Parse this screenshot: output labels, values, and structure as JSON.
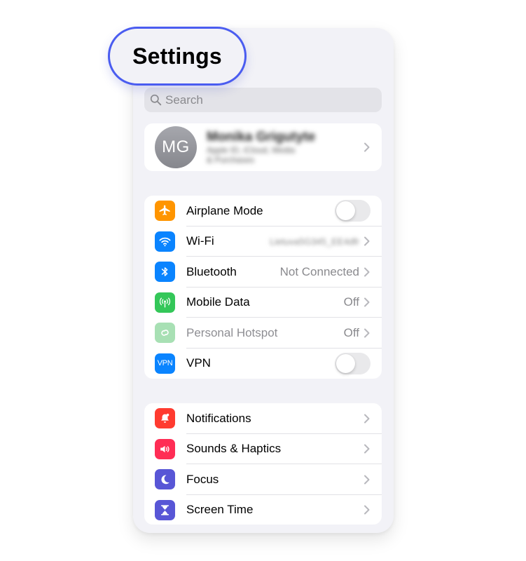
{
  "header": {
    "title": "Settings"
  },
  "search": {
    "placeholder": "Search"
  },
  "profile": {
    "initials": "MG",
    "name": "Monika Grigutyte",
    "subtitle_line1": "Apple ID, iCloud, Media",
    "subtitle_line2": "& Purchases"
  },
  "connectivity": [
    {
      "label": "Airplane Mode",
      "control": "toggle",
      "on": false,
      "color": "#ff9500",
      "icon": "airplane-icon"
    },
    {
      "label": "Wi-Fi",
      "value": "Lietuva5G345_EE4dfr",
      "value_blurred": true,
      "color": "#0a84ff",
      "icon": "wifi-icon"
    },
    {
      "label": "Bluetooth",
      "value": "Not Connected",
      "color": "#0a84ff",
      "icon": "bluetooth-icon"
    },
    {
      "label": "Mobile Data",
      "value": "Off",
      "color": "#34c759",
      "icon": "antenna-icon"
    },
    {
      "label": "Personal Hotspot",
      "value": "Off",
      "dimmed": true,
      "color": "#a8e0b4",
      "icon": "hotspot-icon"
    },
    {
      "label": "VPN",
      "icon_text": "VPN",
      "control": "toggle",
      "on": false,
      "color": "#0a84ff",
      "icon": "vpn-icon"
    }
  ],
  "general": [
    {
      "label": "Notifications",
      "color": "#ff3b30",
      "icon": "bell-icon"
    },
    {
      "label": "Sounds & Haptics",
      "color": "#ff2d55",
      "icon": "speaker-icon"
    },
    {
      "label": "Focus",
      "color": "#5856d6",
      "icon": "moon-icon"
    },
    {
      "label": "Screen Time",
      "color": "#5856d6",
      "icon": "hourglass-icon"
    }
  ]
}
